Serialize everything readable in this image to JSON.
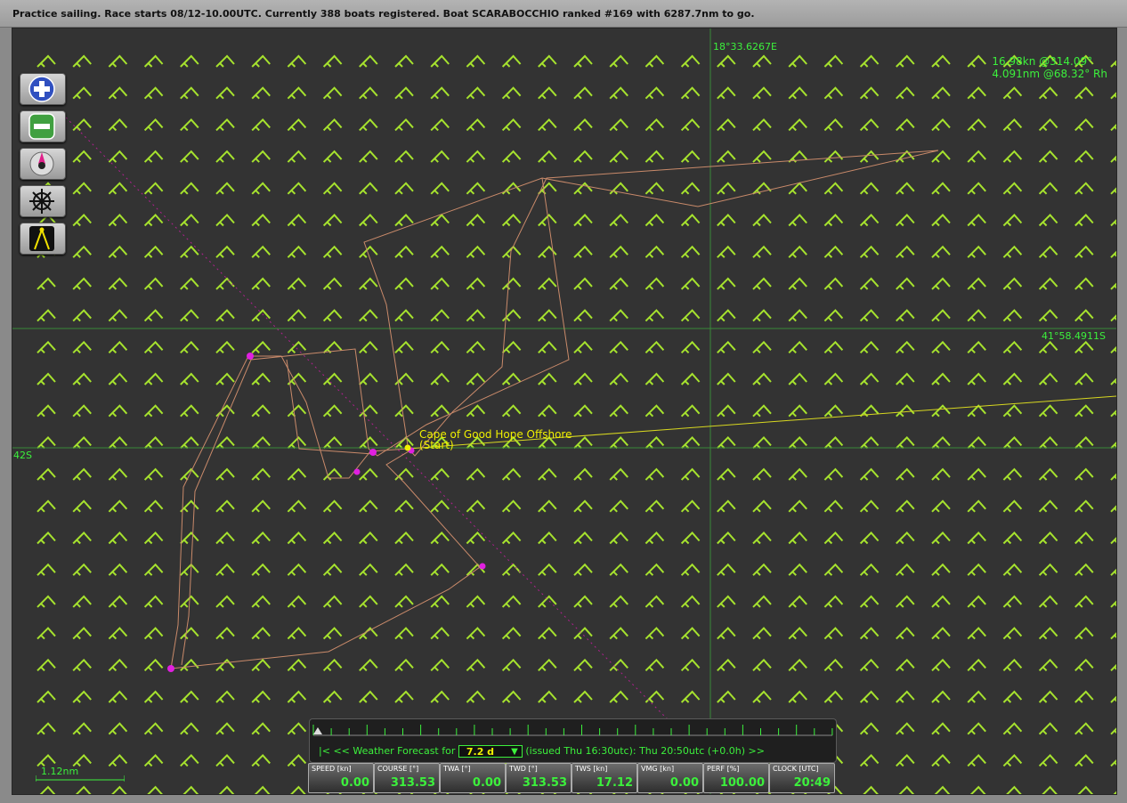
{
  "status": {
    "text": "Practice sailing. Race starts 08/12-10.00UTC. Currently 388 boats registered. Boat SCARABOCCHIO ranked #169 with 6287.7nm to go."
  },
  "map": {
    "longitude_label": "18°33.6267E",
    "latitude_label": "41°58.4911S",
    "lat_axis_label": "42S",
    "readout_line1": "16.98kn @314.09°",
    "readout_line2": "4.091nm @68.32° Rh",
    "place_name": "Cape of Good Hope Offshore",
    "place_sub": "(Start)",
    "scale_label": "1.12nm"
  },
  "colors": {
    "wind_barb": "#a6e22e",
    "track": "#c98a6a",
    "grid": "#3a8a3a",
    "accent_green": "#3cf03c",
    "waypoint": "#e020e0",
    "heading_line": "#e0e020"
  },
  "toolbar": {
    "buttons": [
      {
        "name": "zoom-in-button",
        "icon": "plus-icon"
      },
      {
        "name": "zoom-out-button",
        "icon": "minus-icon"
      },
      {
        "name": "center-boat-button",
        "icon": "compass-icon"
      },
      {
        "name": "helm-button",
        "icon": "helm-wheel-icon"
      },
      {
        "name": "measure-button",
        "icon": "divider-icon"
      }
    ]
  },
  "forecast": {
    "first": "|<",
    "prev": "<<",
    "label": "Weather Forecast for",
    "selected": "7.2 d",
    "issued": "(issued Thu 16:30utc): Thu 20:50utc  (+0.0h)",
    "next": ">>"
  },
  "gauges": [
    {
      "label": "SPEED [kn]",
      "value": "0.00"
    },
    {
      "label": "COURSE [°]",
      "value": "313.53"
    },
    {
      "label": "TWA [°]",
      "value": "0.00"
    },
    {
      "label": "TWD [°]",
      "value": "313.53"
    },
    {
      "label": "TWS [kn]",
      "value": "17.12"
    },
    {
      "label": "VMG [kn]",
      "value": "0.00"
    },
    {
      "label": "PERF [%]",
      "value": "100.00"
    },
    {
      "label": "CLOCK [UTC]",
      "value": "20:49"
    }
  ]
}
